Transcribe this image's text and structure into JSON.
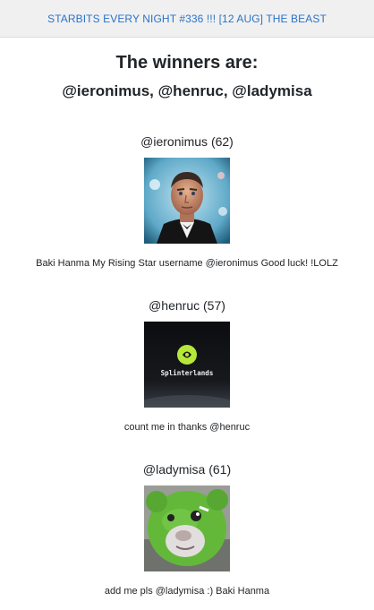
{
  "header": {
    "post_link": "STARBITS EVERY NIGHT #336 !!! [12 AUG] THE BEAST"
  },
  "main": {
    "heading": "The winners are:",
    "winners_list": "@ieronimus, @henruc, @ladymisa",
    "entries": [
      {
        "name": "@ieronimus (62)",
        "comment": "Baki Hanma My Rising Star username @ieronimus Good luck! !LOLZ"
      },
      {
        "name": "@henruc (57)",
        "comment": "count me in thanks @henruc",
        "image_text": "Splinterlands"
      },
      {
        "name": "@ladymisa (61)",
        "comment": "add me pls @ladymisa :) Baki Hanma"
      }
    ]
  },
  "colors": {
    "link": "#2a73c8",
    "topbar_bg": "#f0f0f0",
    "text": "#212529",
    "splinterlands_green": "#b6e83a"
  }
}
